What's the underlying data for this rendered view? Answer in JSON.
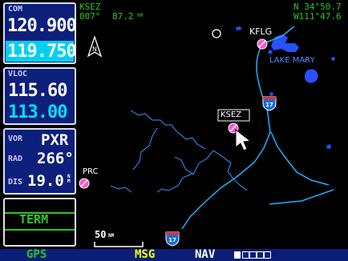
{
  "com": {
    "label": "COM",
    "active": "120.900",
    "standby": "119.750"
  },
  "vloc": {
    "label": "VLOC",
    "active": "115.60",
    "standby": "113.00"
  },
  "vor": {
    "label": "VOR",
    "ident": "PXR",
    "rad_label": "RAD",
    "rad_value": "266°",
    "dis_label": "DIS",
    "dis_value": "19.0",
    "dis_unit": "N M"
  },
  "term": {
    "label": "TERM"
  },
  "map": {
    "waypoint_ident": "KSEZ",
    "bearing": "007°",
    "distance": "87.2",
    "distance_unit": "NM",
    "lat": "N 34°50.7",
    "lon": "W111°47.6",
    "scale": "50",
    "scale_unit": "NM",
    "label_kflg": "KFLG",
    "label_lake": "LAKE MARY",
    "label_ksez": "KSEZ",
    "label_prc": "PRC"
  },
  "statusbar": {
    "gps": "GPS",
    "msg": "MSG",
    "nav": "NAV"
  },
  "colors": {
    "cyan": "#00e0ff",
    "water": "#2850ff",
    "airport": "#ff55cc",
    "statusbar": "#0a1e78",
    "highway": "#0077cc"
  }
}
